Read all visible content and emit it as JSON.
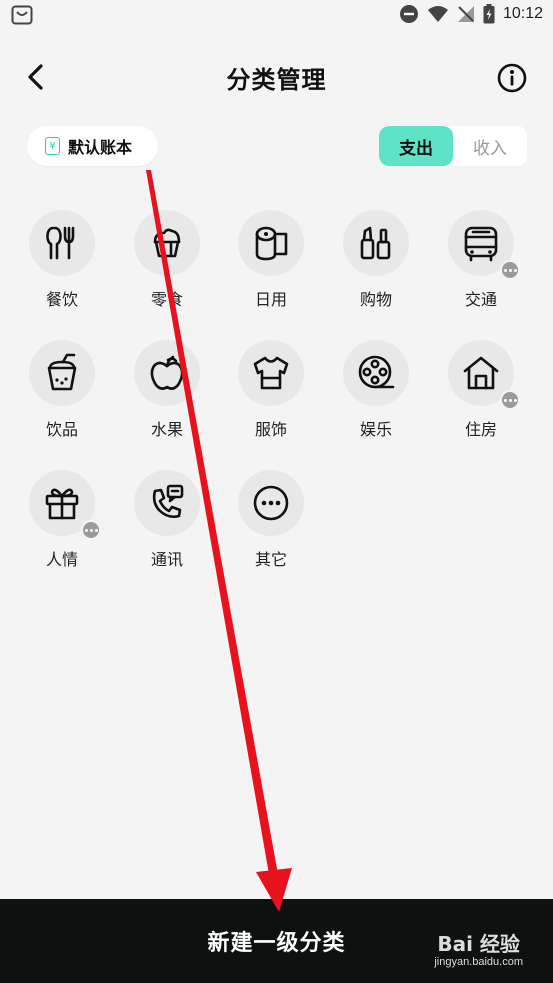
{
  "status_bar": {
    "time": "10:12"
  },
  "header": {
    "title": "分类管理"
  },
  "ledger": {
    "label": "默认账本",
    "icon_text": "¥"
  },
  "toggle": {
    "expense": "支出",
    "income": "收入",
    "active": "expense"
  },
  "categories": [
    {
      "label": "餐饮",
      "icon": "utensils-icon",
      "has_sub": false
    },
    {
      "label": "零食",
      "icon": "cupcake-icon",
      "has_sub": false
    },
    {
      "label": "日用",
      "icon": "toilet-paper-icon",
      "has_sub": false
    },
    {
      "label": "购物",
      "icon": "cosmetics-icon",
      "has_sub": false
    },
    {
      "label": "交通",
      "icon": "bus-icon",
      "has_sub": true
    },
    {
      "label": "饮品",
      "icon": "bubble-tea-icon",
      "has_sub": false
    },
    {
      "label": "水果",
      "icon": "apple-icon",
      "has_sub": false
    },
    {
      "label": "服饰",
      "icon": "tshirt-icon",
      "has_sub": false
    },
    {
      "label": "娱乐",
      "icon": "film-reel-icon",
      "has_sub": false
    },
    {
      "label": "住房",
      "icon": "house-icon",
      "has_sub": true
    },
    {
      "label": "人情",
      "icon": "gift-icon",
      "has_sub": true
    },
    {
      "label": "通讯",
      "icon": "phone-chat-icon",
      "has_sub": false
    },
    {
      "label": "其它",
      "icon": "more-circle-icon",
      "has_sub": false
    }
  ],
  "bottom_button": {
    "label": "新建一级分类"
  },
  "watermark": {
    "main": "Bai 经验",
    "sub": "jingyan.baidu.com"
  },
  "colors": {
    "accent": "#5fe3c6",
    "arrow": "#e8121e",
    "bottom_bar": "#0d1110"
  }
}
